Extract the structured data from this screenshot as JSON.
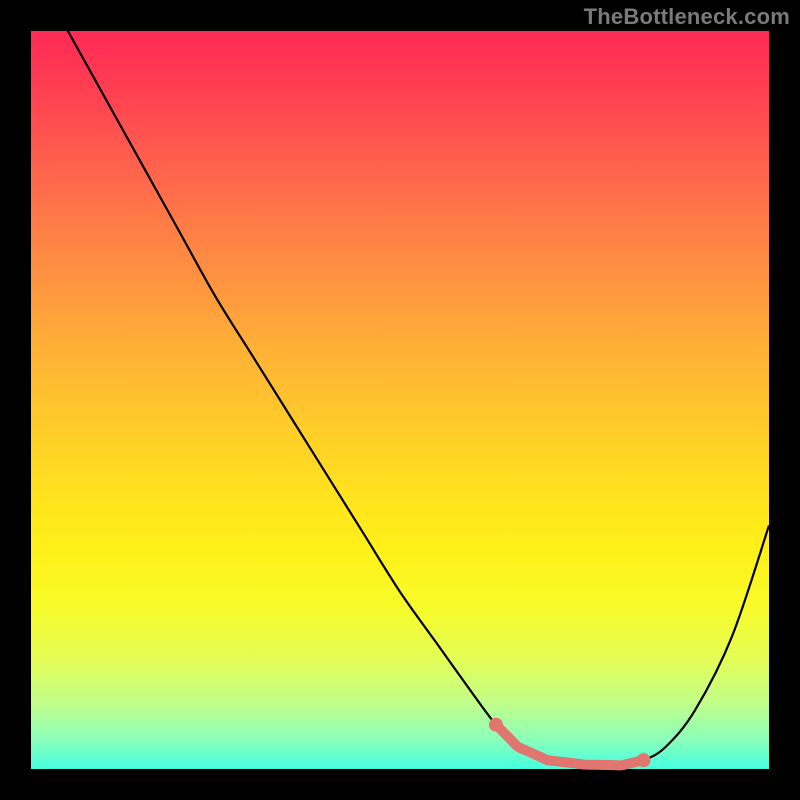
{
  "watermark": "TheBottleneck.com",
  "chart_data": {
    "type": "line",
    "title": "",
    "xlabel": "",
    "ylabel": "",
    "xlim": [
      0,
      100
    ],
    "ylim": [
      0,
      100
    ],
    "series": [
      {
        "name": "curve",
        "x": [
          5,
          10,
          15,
          20,
          25,
          30,
          35,
          40,
          45,
          50,
          55,
          60,
          63,
          66,
          70,
          75,
          80,
          83,
          86,
          90,
          95,
          100
        ],
        "y": [
          100,
          91,
          82,
          73,
          64,
          56,
          48,
          40,
          32,
          24,
          17,
          10,
          6,
          3,
          1.2,
          0.6,
          0.5,
          1.2,
          3,
          8,
          18,
          33
        ]
      }
    ],
    "highlight_segment": {
      "start_x": 63,
      "end_x": 83,
      "color": "#e0766f"
    }
  }
}
